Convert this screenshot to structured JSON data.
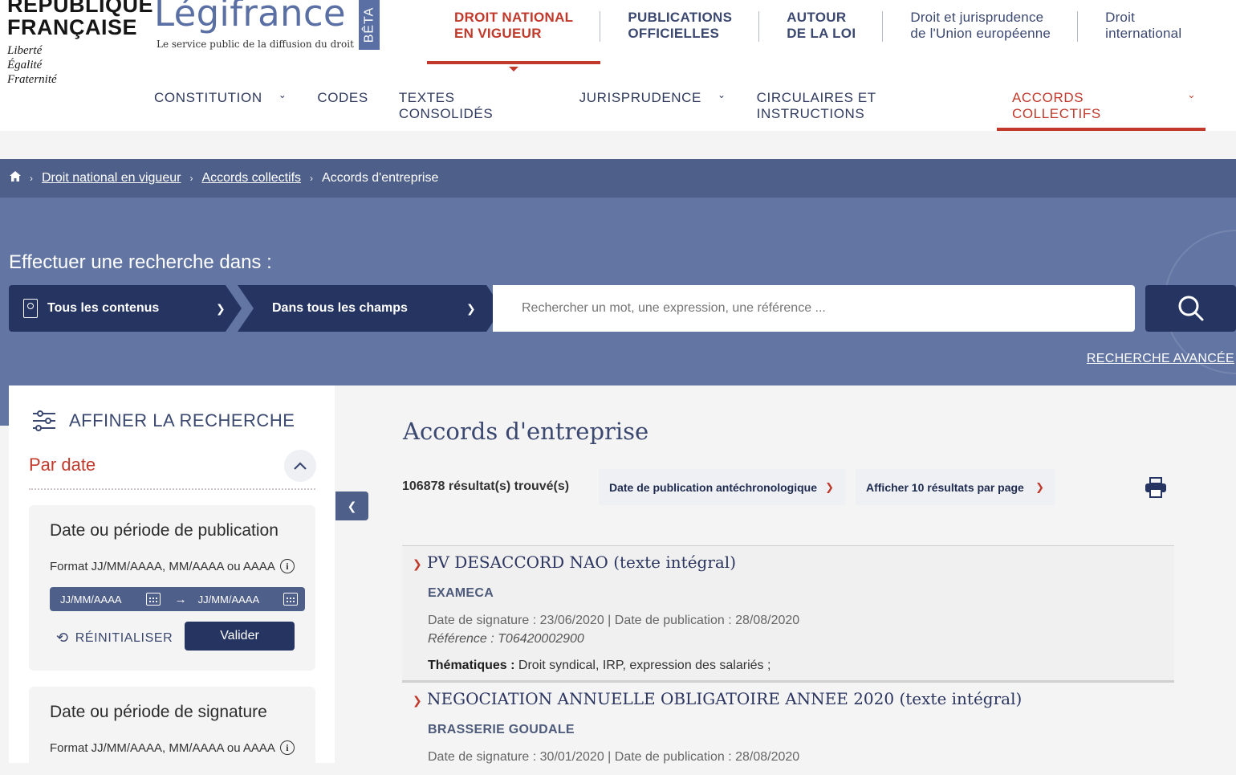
{
  "brand": {
    "rf_title_line1": "RÉPUBLIQUE",
    "rf_title_line2": "FRANÇAISE",
    "motto_1": "Liberté",
    "motto_2": "Égalité",
    "motto_3": "Fraternité",
    "site_name": "Légifrance",
    "tagline": "Le service public de la diffusion du droit",
    "beta": "BÊTA"
  },
  "topnav": [
    {
      "line1": "DROIT NATIONAL",
      "line2": "EN VIGUEUR"
    },
    {
      "line1": "PUBLICATIONS",
      "line2": "OFFICIELLES"
    },
    {
      "line1": "AUTOUR",
      "line2": "DE LA LOI"
    },
    {
      "line1": "Droit et jurisprudence",
      "line2": "de l'Union européenne"
    },
    {
      "line1": "Droit",
      "line2": "international"
    }
  ],
  "subnav": [
    "CONSTITUTION",
    "CODES",
    "TEXTES CONSOLIDÉS",
    "JURISPRUDENCE",
    "CIRCULAIRES ET INSTRUCTIONS",
    "ACCORDS COLLECTIFS"
  ],
  "breadcrumb": [
    "Droit national en vigueur",
    "Accords collectifs",
    "Accords d'entreprise"
  ],
  "search": {
    "title": "Effectuer une recherche dans :",
    "scope": "Tous les contenus",
    "fields": "Dans tous les champs",
    "placeholder": "Rechercher un mot, une expression, une référence ...",
    "advanced": "RECHERCHE AVANCÉE"
  },
  "sidebar": {
    "refine_title": "AFFINER LA RECHERCHE",
    "section": "Par date",
    "pub_card": {
      "title": "Date ou période de publication",
      "format": "Format JJ/MM/AAAA, MM/AAAA ou AAAA",
      "from_placeholder": "JJ/MM/AAAA",
      "to_placeholder": "JJ/MM/AAAA",
      "reset": "RÉINITIALISER",
      "validate": "Valider"
    },
    "sig_card": {
      "title": "Date ou période de signature",
      "format": "Format JJ/MM/AAAA, MM/AAAA ou AAAA"
    }
  },
  "main": {
    "title": "Accords d'entreprise",
    "count": "106878 résultat(s) trouvé(s)",
    "sort": "Date de publication antéchronologique",
    "per_page": "Afficher 10 résultats par page"
  },
  "results": [
    {
      "title": "PV DESACCORD NAO (texte intégral)",
      "company": "EXAMECA",
      "dates": "Date de signature : 23/06/2020 | Date de publication : 28/08/2020",
      "reference": "Référence : T06420002900",
      "themes_label": "Thématiques :",
      "themes": " Droit syndical, IRP, expression des salariés ;"
    },
    {
      "title": "NEGOCIATION ANNUELLE OBLIGATOIRE ANNEE 2020 (texte intégral)",
      "company": "BRASSERIE GOUDALE",
      "dates": "Date de signature : 30/01/2020 | Date de publication : 28/08/2020"
    }
  ],
  "colors": {
    "accent_red": "#c0392b",
    "navy": "#253460",
    "band": "#6275a3",
    "breadcrumb": "#4e5f8a"
  }
}
